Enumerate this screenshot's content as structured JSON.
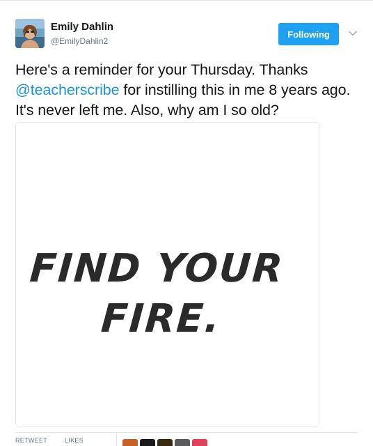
{
  "tweet": {
    "author": {
      "name": "Emily Dahlin",
      "handle": "@EmilyDahlin2"
    },
    "follow_button": "Following",
    "text_parts": {
      "before": "Here's a reminder for your Thursday. Thanks ",
      "mention": "@teacherscribe",
      "after": " for instilling this in me 8 years ago. It's never left me. Also, why am I so old?"
    },
    "image": {
      "line1": "FIND YOUR",
      "line2": "FIRE."
    },
    "stats": {
      "retweets_label": "RETWEET",
      "likes_label": "LIKES"
    },
    "liker_colors": [
      "#c8602a",
      "#1a1a1a",
      "#3a2a10",
      "#5a5a5a",
      "#e0405a"
    ]
  },
  "icons": {
    "more": "chevron-down-icon"
  },
  "colors": {
    "accent": "#1da1f2",
    "link": "#1b95e0",
    "muted": "#657786"
  }
}
